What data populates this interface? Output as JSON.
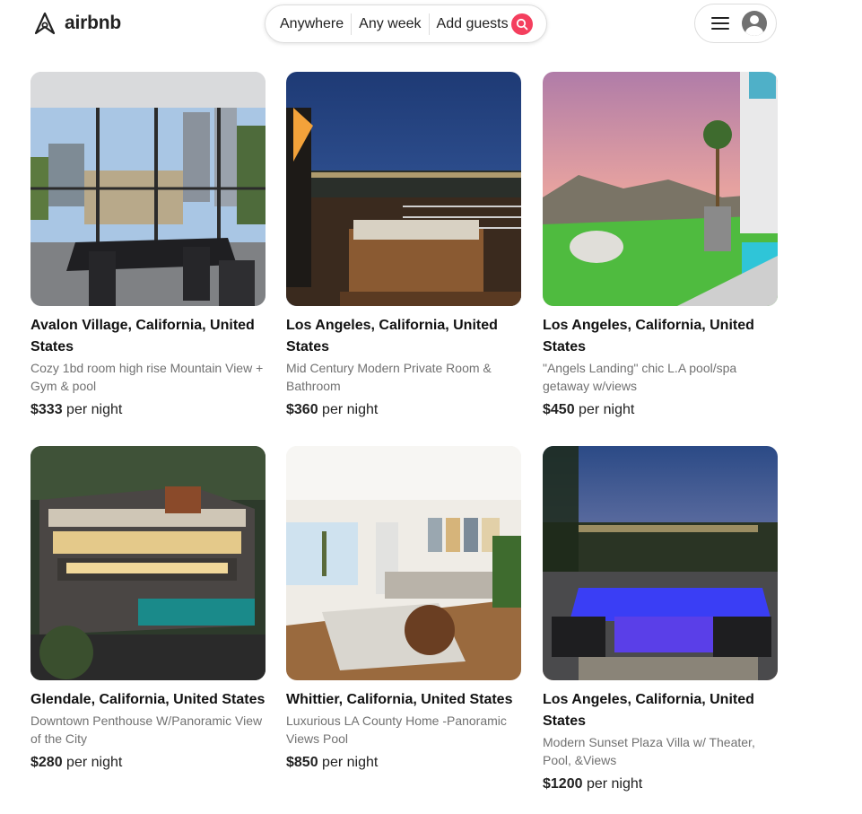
{
  "header": {
    "brand": "airbnb",
    "search": {
      "location": "Anywhere",
      "dates": "Any week",
      "guests": "Add guests"
    }
  },
  "colors": {
    "brand": "#F43F5E",
    "text": "#222222",
    "muted": "#717171",
    "border": "#dddddd"
  },
  "icons": {
    "logo": "airbnb-logo-icon",
    "search": "search-icon",
    "menu": "hamburger-menu-icon",
    "user": "user-avatar-icon"
  },
  "listings": [
    {
      "location": "Avalon Village, California, United States",
      "description": "Cozy 1bd room high rise Mountain View + Gym & pool",
      "price": "$333",
      "price_suffix": "per night"
    },
    {
      "location": "Los Angeles, California, United States",
      "description": "Mid Century Modern Private Room & Bathroom",
      "price": "$360",
      "price_suffix": "per night"
    },
    {
      "location": "Los Angeles, California, United States",
      "description": "\"Angels Landing\" chic L.A pool/spa getaway w/views",
      "price": "$450",
      "price_suffix": "per night"
    },
    {
      "location": "Glendale, California, United States",
      "description": "Downtown Penthouse W/Panoramic View of the City",
      "price": "$280",
      "price_suffix": "per night"
    },
    {
      "location": "Whittier, California, United States",
      "description": "Luxurious LA County Home -Panoramic Views Pool",
      "price": "$850",
      "price_suffix": "per night"
    },
    {
      "location": "Los Angeles, California, United States",
      "description": "Modern Sunset Plaza Villa w/ Theater, Pool, &Views",
      "price": "$1200",
      "price_suffix": "per night"
    }
  ]
}
